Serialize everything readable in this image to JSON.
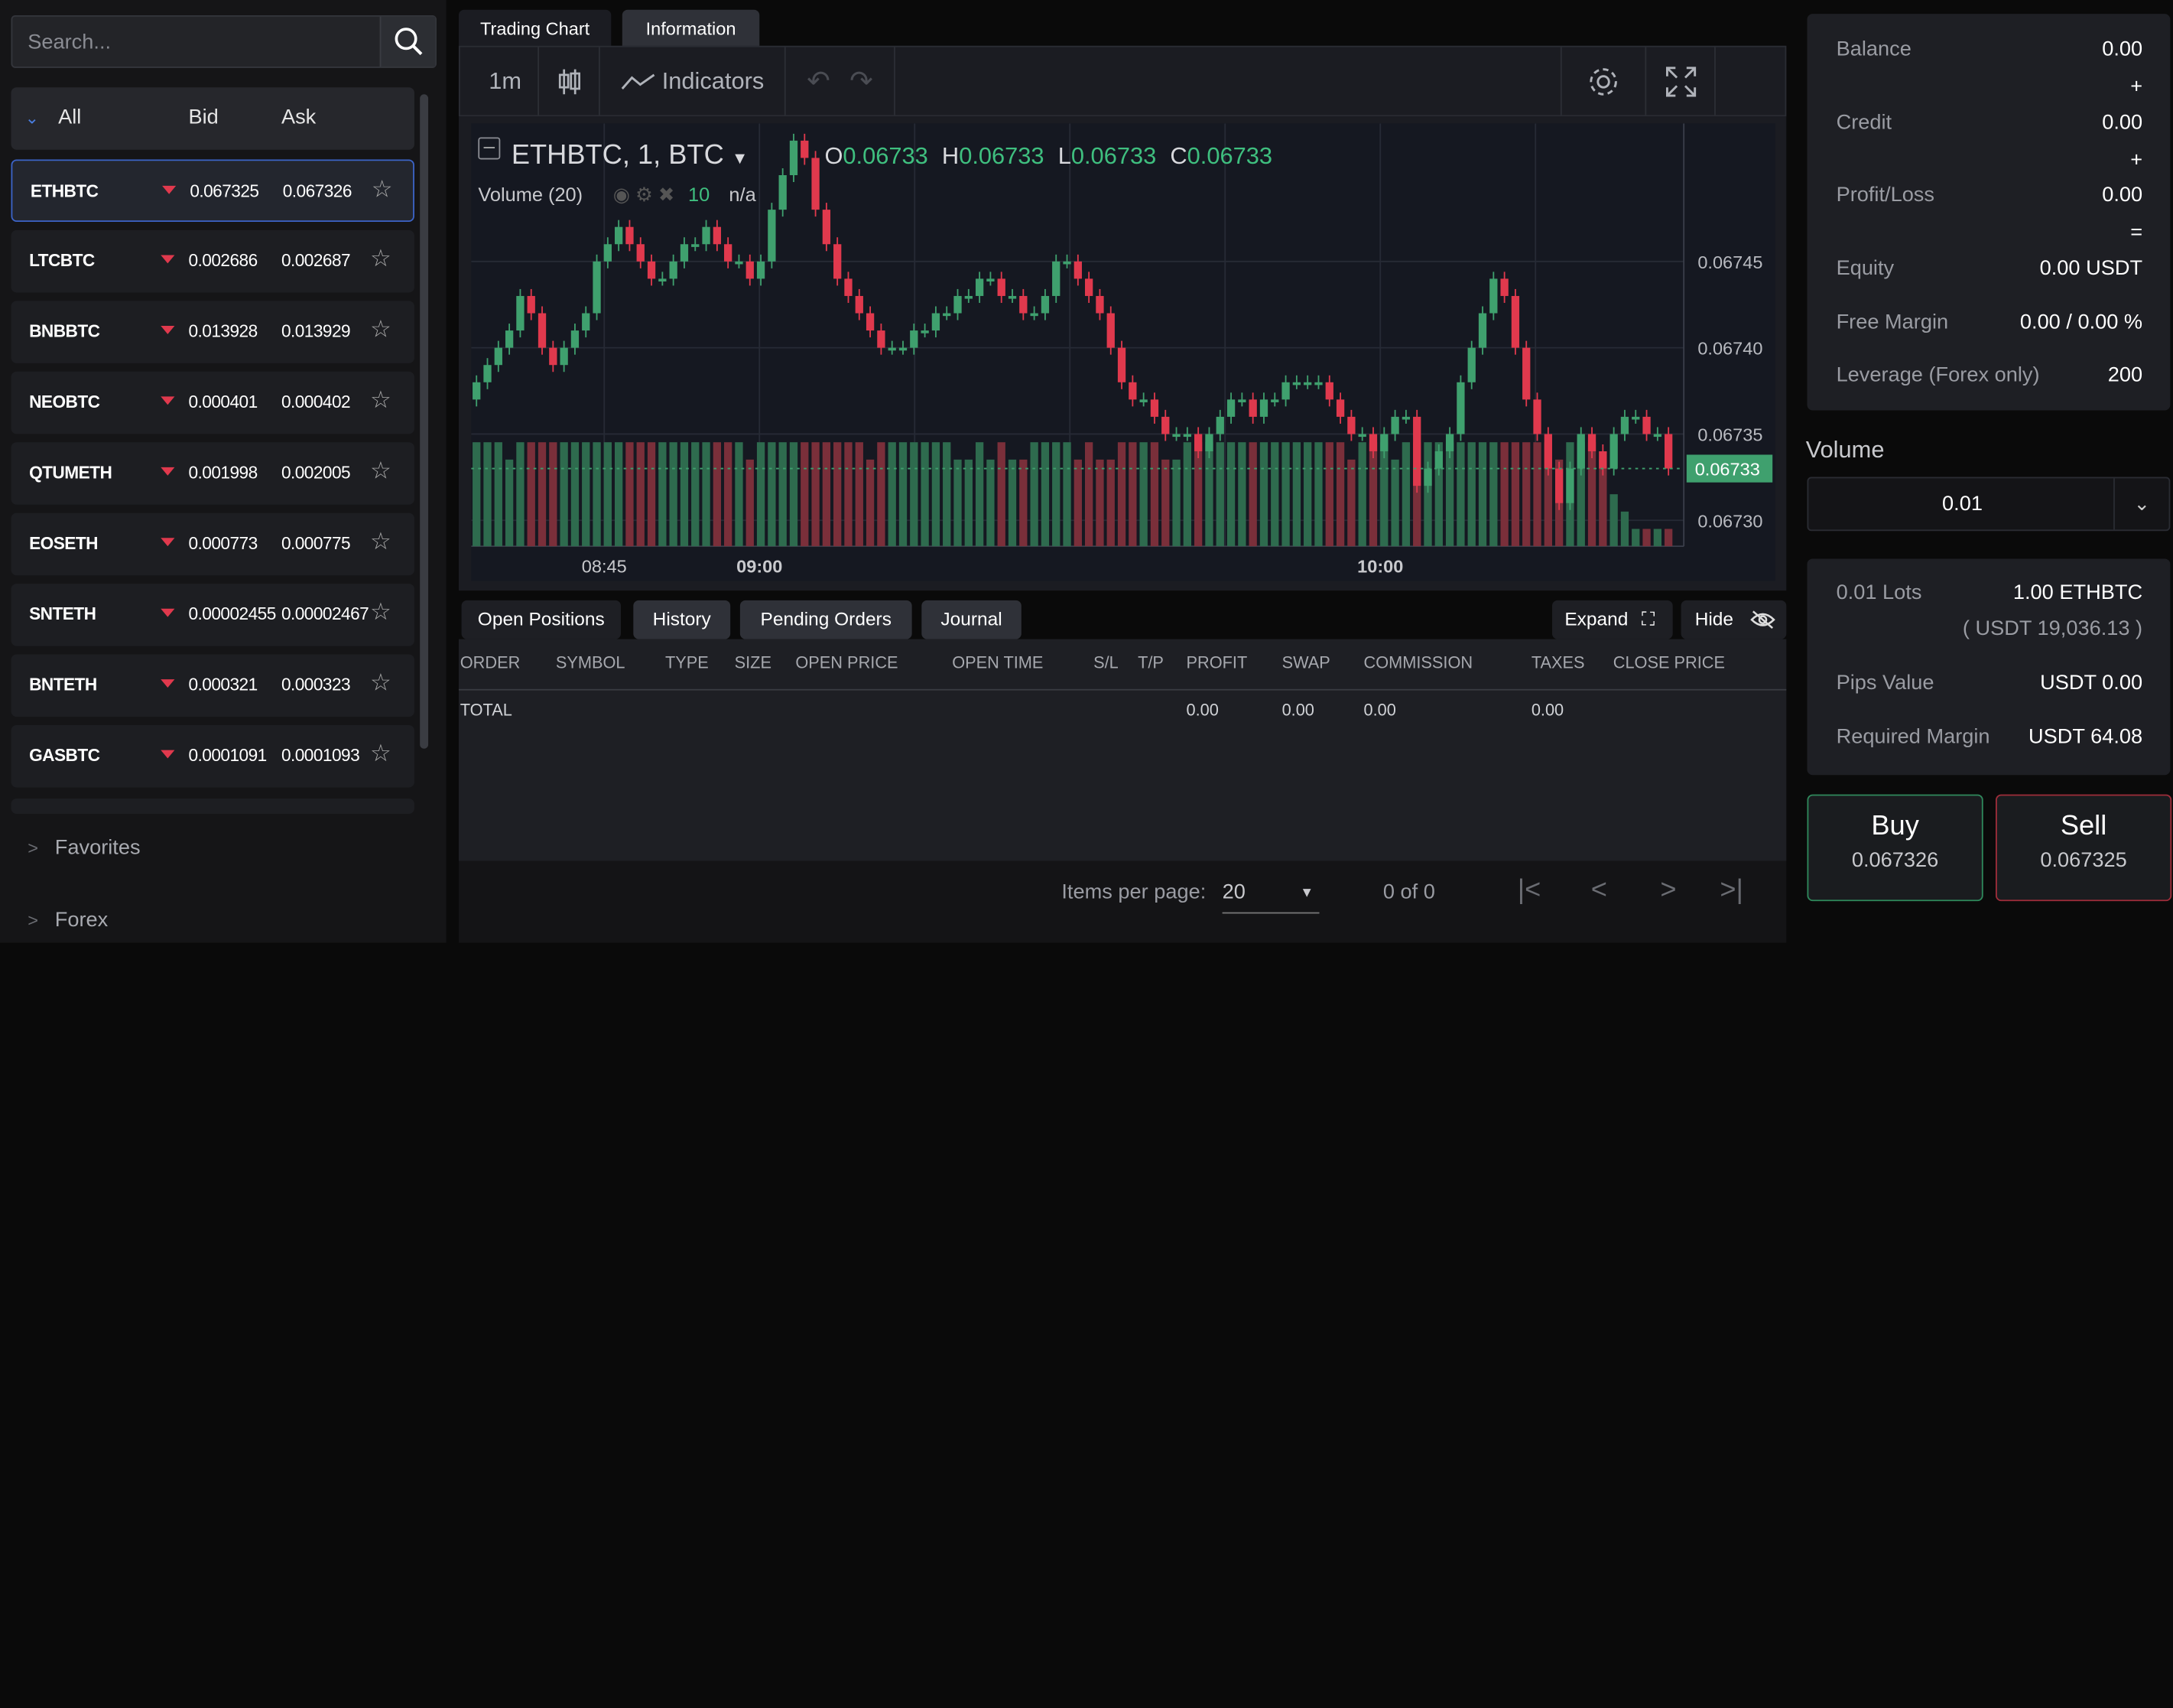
{
  "search": {
    "placeholder": "Search..."
  },
  "market_header": {
    "group": "All",
    "bid": "Bid",
    "ask": "Ask"
  },
  "markets": [
    {
      "symbol": "ETHBTC",
      "bid": "0.067325",
      "ask": "0.067326"
    },
    {
      "symbol": "LTCBTC",
      "bid": "0.002686",
      "ask": "0.002687"
    },
    {
      "symbol": "BNBBTC",
      "bid": "0.013928",
      "ask": "0.013929"
    },
    {
      "symbol": "NEOBTC",
      "bid": "0.000401",
      "ask": "0.000402"
    },
    {
      "symbol": "QTUMETH",
      "bid": "0.001998",
      "ask": "0.002005"
    },
    {
      "symbol": "EOSETH",
      "bid": "0.000773",
      "ask": "0.000775"
    },
    {
      "symbol": "SNTETH",
      "bid": "0.00002455",
      "ask": "0.00002467"
    },
    {
      "symbol": "BNTETH",
      "bid": "0.000321",
      "ask": "0.000323"
    },
    {
      "symbol": "GASBTC",
      "bid": "0.0001091",
      "ask": "0.0001093"
    }
  ],
  "groups": {
    "favorites": "Favorites",
    "forex": "Forex"
  },
  "tabs": {
    "trading_chart": "Trading Chart",
    "information": "Information"
  },
  "toolbar": {
    "interval": "1m",
    "indicators": "Indicators"
  },
  "chart_data": {
    "type": "candlestick",
    "title": "ETHBTC, 1, BTC",
    "ohlc": {
      "o_label": "O",
      "o": "0.06733",
      "h_label": "H",
      "h": "0.06733",
      "l_label": "L",
      "l": "0.06733",
      "c_label": "C",
      "c": "0.06733"
    },
    "volume_label": "Volume (20)",
    "volume_value": "10",
    "volume_na": "n/a",
    "y_ticks": [
      "0.06745",
      "0.06740",
      "0.06735",
      "0.06730"
    ],
    "last_price": "0.06733",
    "x_ticks": [
      "08:45",
      "09:00",
      "10:00"
    ],
    "ylim": [
      0.067285,
      0.06753
    ],
    "close": [
      0.06738,
      0.06739,
      0.0674,
      0.06741,
      0.06743,
      0.06742,
      0.0674,
      0.06739,
      0.0674,
      0.06741,
      0.06742,
      0.06745,
      0.06746,
      0.06747,
      0.06746,
      0.06745,
      0.06744,
      0.06744,
      0.06745,
      0.06746,
      0.06746,
      0.06747,
      0.06746,
      0.06745,
      0.06745,
      0.06744,
      0.06745,
      0.06748,
      0.0675,
      0.06752,
      0.06751,
      0.06748,
      0.06746,
      0.06744,
      0.06743,
      0.06742,
      0.06741,
      0.0674,
      0.0674,
      0.0674,
      0.06741,
      0.06741,
      0.06742,
      0.06742,
      0.06743,
      0.06743,
      0.06744,
      0.06744,
      0.06743,
      0.06743,
      0.06742,
      0.06742,
      0.06743,
      0.06745,
      0.06745,
      0.06744,
      0.06743,
      0.06742,
      0.0674,
      0.06738,
      0.06737,
      0.06737,
      0.06736,
      0.06735,
      0.06735,
      0.06735,
      0.06734,
      0.06735,
      0.06736,
      0.06737,
      0.06737,
      0.06736,
      0.06737,
      0.06737,
      0.06738,
      0.06738,
      0.06738,
      0.06738,
      0.06737,
      0.06736,
      0.06735,
      0.06735,
      0.06734,
      0.06735,
      0.06736,
      0.06736,
      0.06732,
      0.06733,
      0.06734,
      0.06735,
      0.06738,
      0.0674,
      0.06742,
      0.06744,
      0.06743,
      0.0674,
      0.06737,
      0.06735,
      0.06733,
      0.06731,
      0.06733,
      0.06735,
      0.06734,
      0.06733,
      0.06735,
      0.06736,
      0.06736,
      0.06735,
      0.06735,
      0.06733
    ],
    "volume": [
      6,
      6,
      6,
      5,
      6,
      6,
      6,
      6,
      6,
      6,
      6,
      6,
      6,
      6,
      6,
      6,
      6,
      6,
      6,
      6,
      6,
      6,
      6,
      6,
      6,
      5,
      6,
      6,
      6,
      6,
      6,
      6,
      6,
      6,
      6,
      6,
      5,
      6,
      6,
      6,
      6,
      6,
      6,
      6,
      5,
      5,
      6,
      5,
      6,
      5,
      5,
      6,
      6,
      6,
      6,
      5,
      6,
      5,
      5,
      6,
      6,
      6,
      6,
      5,
      5,
      6,
      6,
      6,
      6,
      6,
      6,
      6,
      6,
      6,
      6,
      6,
      6,
      6,
      6,
      6,
      5,
      6,
      6,
      6,
      5,
      6,
      6,
      6,
      6,
      6,
      6,
      6,
      6,
      6,
      6,
      6,
      6,
      6,
      6,
      5,
      6,
      6,
      6,
      5,
      3,
      2,
      1,
      1,
      1,
      1
    ]
  },
  "bottom_tabs": {
    "open_positions": "Open Positions",
    "history": "History",
    "pending_orders": "Pending Orders",
    "journal": "Journal",
    "expand": "Expand",
    "hide": "Hide"
  },
  "table": {
    "columns": [
      "ORDER",
      "SYMBOL",
      "TYPE",
      "SIZE",
      "OPEN PRICE",
      "OPEN TIME",
      "S/L",
      "T/P",
      "PROFIT",
      "SWAP",
      "COMMISSION",
      "TAXES",
      "CLOSE PRICE"
    ],
    "total": {
      "label": "TOTAL",
      "profit": "0.00",
      "swap": "0.00",
      "commission": "0.00",
      "taxes": "0.00"
    }
  },
  "pager": {
    "items_per_page_label": "Items per page:",
    "items_per_page": "20",
    "range": "0 of 0"
  },
  "account": {
    "balance_label": "Balance",
    "balance": "0.00",
    "plus1": "+",
    "credit_label": "Credit",
    "credit": "0.00",
    "plus2": "+",
    "pl_label": "Profit/Loss",
    "pl": "0.00",
    "eq": "=",
    "equity_label": "Equity",
    "equity": "0.00 USDT",
    "free_margin_label": "Free Margin",
    "free_margin": "0.00 / 0.00 %",
    "leverage_label": "Leverage (Forex only)",
    "leverage": "200"
  },
  "volume": {
    "label": "Volume",
    "value": "0.01"
  },
  "info": {
    "lots": "0.01 Lots",
    "lots_value": "1.00 ETHBTC",
    "usdt_value": "( USDT 19,036.13 )",
    "pips_label": "Pips Value",
    "pips": "USDT 0.00",
    "margin_label": "Required Margin",
    "margin": "USDT 64.08"
  },
  "buy": {
    "label": "Buy",
    "price": "0.067326"
  },
  "sell": {
    "label": "Sell",
    "price": "0.067325"
  },
  "colors": {
    "up": "#3fa06e",
    "down": "#e0394d",
    "accent": "#3c64c8"
  }
}
